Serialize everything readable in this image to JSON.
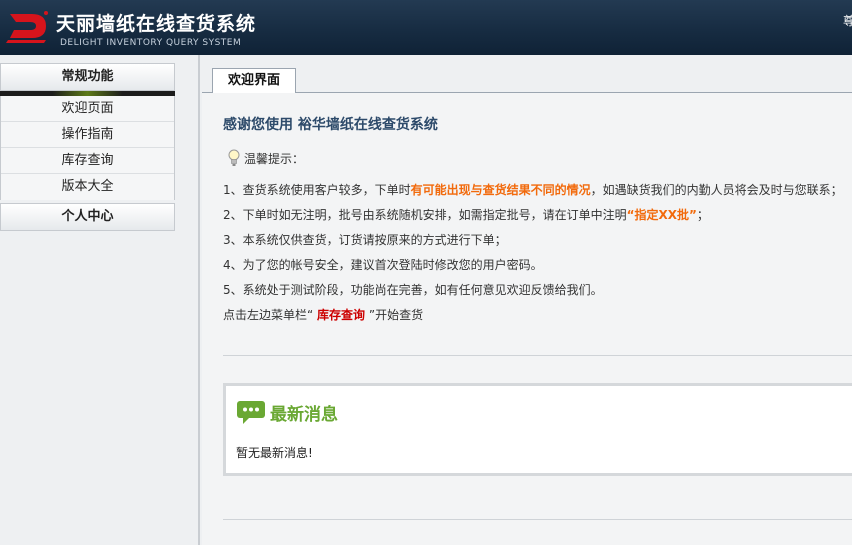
{
  "header": {
    "title": "天丽墙纸在线查货系统",
    "subtitle": "DELIGHT INVENTORY QUERY SYSTEM",
    "right_text": "尊"
  },
  "sidebar": {
    "section1": "常规功能",
    "items": [
      {
        "label": "欢迎页面"
      },
      {
        "label": "操作指南"
      },
      {
        "label": "库存查询"
      },
      {
        "label": "版本大全"
      }
    ],
    "section2": "个人中心"
  },
  "tabs": [
    {
      "label": "欢迎界面"
    }
  ],
  "welcome": {
    "title": "感谢您使用 裕华墙纸在线查货系统",
    "tip_heading": "温馨提示：",
    "line1_a": "1、查货系统使用客户较多，下单时",
    "line1_b": "有可能出现与查货结果不同的情况",
    "line1_c": "，如遇缺货我们的内勤人员将会及时与您联系；",
    "line2_a": "2、下单时如无注明，批号由系统随机安排，如需指定批号，请在订单中注明",
    "line2_b": "“指定XX批”",
    "line2_c": "；",
    "line3": "3、本系统仅供查货，订货请按原来的方式进行下单；",
    "line4": "4、为了您的帐号安全，建议首次登陆时修改您的用户密码。",
    "line5": "5、系统处于测试阶段，功能尚在完善，如有任何意见欢迎反馈给我们。",
    "line6_a": "点击左边菜单栏“ ",
    "line6_b": "库存查询",
    "line6_c": " ”开始查货"
  },
  "news": {
    "title": "最新消息",
    "body": "暂无最新消息!"
  },
  "colors": {
    "header_bg": "#1a2f46",
    "accent_orange": "#f26a0c",
    "accent_red": "#cc0000",
    "title_blue": "#2d4a6a",
    "news_green": "#6aa833"
  },
  "icons": [
    "logo-icon",
    "bulb-icon",
    "chat-bubble-icon"
  ]
}
